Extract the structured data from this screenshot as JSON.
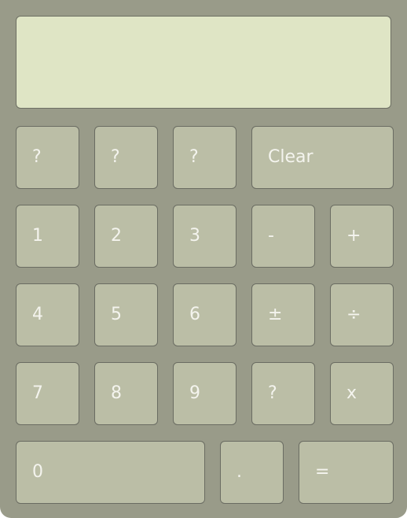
{
  "display": {
    "value": ""
  },
  "keys": {
    "q1": "?",
    "q2": "?",
    "q3": "?",
    "clear": "Clear",
    "one": "1",
    "two": "2",
    "three": "3",
    "minus": "-",
    "plus": "+",
    "four": "4",
    "five": "5",
    "six": "6",
    "plusminus": "±",
    "divide": "÷",
    "seven": "7",
    "eight": "8",
    "nine": "9",
    "q4": "?",
    "multiply": "x",
    "zero": "0",
    "decimal": ".",
    "equals": "="
  }
}
